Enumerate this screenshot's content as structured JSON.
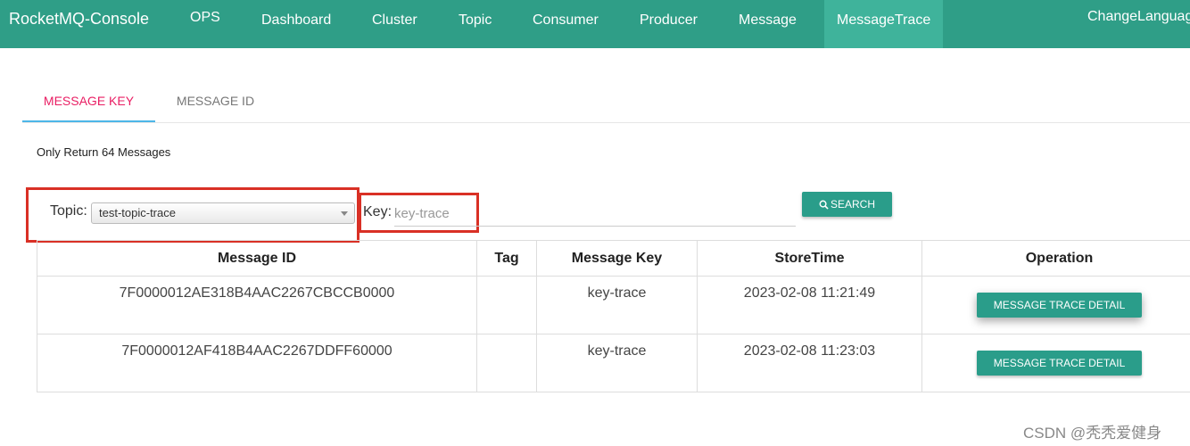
{
  "nav": {
    "brand": "RocketMQ-Console",
    "items": [
      "OPS",
      "Dashboard",
      "Cluster",
      "Topic",
      "Consumer",
      "Producer",
      "Message",
      "MessageTrace"
    ],
    "active": "MessageTrace",
    "language": "ChangeLanguage"
  },
  "tabs": [
    {
      "label": "MESSAGE KEY",
      "active": true
    },
    {
      "label": "MESSAGE ID",
      "active": false
    }
  ],
  "note": "Only Return 64 Messages",
  "form": {
    "topic_label": "Topic:",
    "topic_value": "test-topic-trace",
    "key_label": "Key:",
    "key_placeholder": "key-trace",
    "search_label": "SEARCH"
  },
  "table": {
    "headers": [
      "Message ID",
      "Tag",
      "Message Key",
      "StoreTime",
      "Operation"
    ],
    "rows": [
      {
        "message_id": "7F0000012AE318B4AAC2267CBCCB0000",
        "tag": "",
        "message_key": "key-trace",
        "store_time": "2023-02-08 11:21:49",
        "operation": "MESSAGE TRACE DETAIL"
      },
      {
        "message_id": "7F0000012AF418B4AAC2267DDFF60000",
        "tag": "",
        "message_key": "key-trace",
        "store_time": "2023-02-08 11:23:03",
        "operation": "MESSAGE TRACE DETAIL"
      }
    ]
  },
  "watermark": "CSDN @秃秃爱健身",
  "colors": {
    "navbar": "#2f9e87",
    "nav_active": "#3fb39b",
    "button": "#2a9d8a",
    "tab_active_text": "#e91e63",
    "tab_indicator": "#4db6e8",
    "highlight_box": "#d93025"
  }
}
